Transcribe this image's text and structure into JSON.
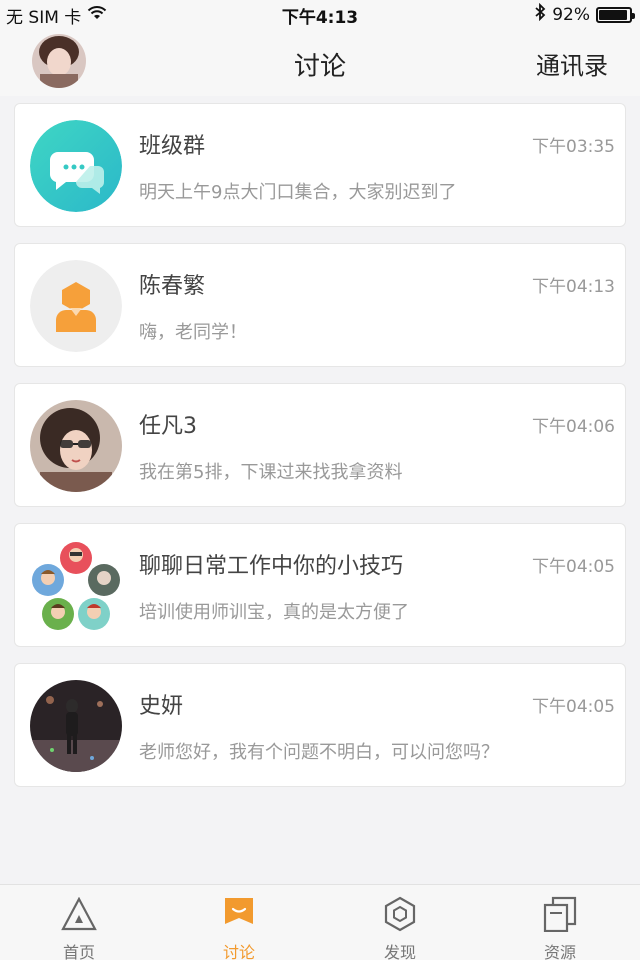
{
  "status_bar": {
    "carrier": "无 SIM 卡",
    "time": "下午4:13",
    "battery": "92%",
    "battery_level": 0.92
  },
  "header": {
    "title": "讨论",
    "contacts_label": "通讯录"
  },
  "conversations": [
    {
      "name": "班级群",
      "time": "下午03:35",
      "message": "明天上午9点大门口集合，大家别迟到了"
    },
    {
      "name": "陈春繁",
      "time": "下午04:13",
      "message": "嗨，老同学！"
    },
    {
      "name": "任凡3",
      "time": "下午04:06",
      "message": "我在第5排，下课过来找我拿资料"
    },
    {
      "name": "聊聊日常工作中你的小技巧",
      "time": "下午04:05",
      "message": "培训使用师训宝，真的是太方便了"
    },
    {
      "name": "史妍",
      "time": "下午04:05",
      "message": "老师您好，我有个问题不明白，可以问您吗？"
    }
  ],
  "tabs": [
    {
      "label": "首页"
    },
    {
      "label": "讨论"
    },
    {
      "label": "发现"
    },
    {
      "label": "资源"
    }
  ],
  "colors": {
    "accent": "#f29a2e",
    "group_chat_icon": "#35c9c4",
    "default_avatar_bg": "#eeeeee",
    "default_avatar_fg": "#f6a03a"
  }
}
